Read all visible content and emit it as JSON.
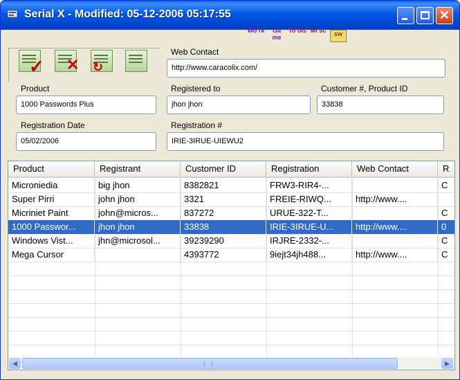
{
  "window": {
    "title": "Serial X - Modified: 05-12-2006 05:17:55",
    "accent": "#0054e3"
  },
  "toolbar": {
    "top_icons": [
      "Wo rk",
      "Ga me",
      "To ols",
      "Mi sc",
      "sw"
    ],
    "action_icons": [
      "add-serial-icon",
      "delete-serial-icon",
      "edit-serial-icon",
      "view-serial-icon"
    ]
  },
  "form": {
    "web_contact": {
      "label": "Web Contact",
      "value": "http://www.caracolix.com/"
    },
    "product": {
      "label": "Product",
      "value": "1000 Passwords Plus"
    },
    "registered_to": {
      "label": "Registered to",
      "value": "jhon jhon"
    },
    "customer_id": {
      "label": "Customer #, Product ID",
      "value": "33838"
    },
    "registration_date": {
      "label": "Registration Date",
      "value": "05/02/2006"
    },
    "registration_no": {
      "label": "Registration #",
      "value": "IRIE-3IRUE-UIEWU2"
    }
  },
  "table": {
    "columns": [
      "Product",
      "Registrant",
      "Customer ID",
      "Registration",
      "Web Contact",
      "R"
    ],
    "rows": [
      [
        "Microniedia",
        "big jhon",
        "8382821",
        "FRW3-RIR4-...",
        "",
        "C"
      ],
      [
        "Super Pirri",
        "john jhon",
        "3321",
        "FREIE-RIWQ...",
        "http://www....",
        ""
      ],
      [
        "Micriniet Paint",
        "john@micros...",
        "837272",
        "URUE-322-T...",
        "",
        "C"
      ],
      [
        "1000 Passwor...",
        "jhon jhon",
        "33838",
        "IRIE-3IRUE-U...",
        "http://www....",
        "0"
      ],
      [
        "Windows Vist...",
        "jhn@microsol...",
        "39239290",
        "IRJRE-2332-...",
        "",
        "C"
      ],
      [
        "Mega Cursor",
        "",
        "4393772",
        "9iejt34jh488...",
        "http://www....",
        "C"
      ]
    ],
    "selected_index": 3
  }
}
